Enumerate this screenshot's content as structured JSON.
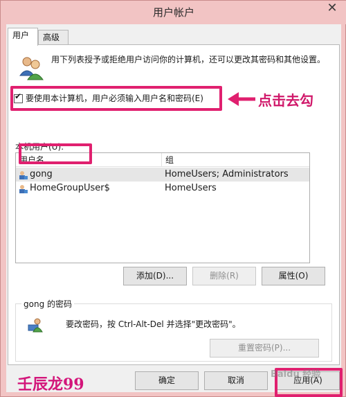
{
  "window": {
    "title": "用户帐户",
    "close_glyph": "✕"
  },
  "tabs": [
    {
      "label": "用户",
      "active": true
    },
    {
      "label": "高级",
      "active": false
    }
  ],
  "description": "用下列表授予或拒绝用户访问你的计算机，还可以更改其密码和其他设置。",
  "require_login": {
    "label": "要使用本计算机，用户必须输入用户名和密码(E)",
    "checked": true
  },
  "users_list": {
    "label": "本机用户(U):",
    "columns": [
      "用户名",
      "组"
    ],
    "rows": [
      {
        "name": "gong",
        "group": "HomeUsers; Administrators",
        "selected": true
      },
      {
        "name": "HomeGroupUser$",
        "group": "HomeUsers",
        "selected": false
      }
    ]
  },
  "list_buttons": {
    "add": "添加(D)...",
    "remove": "删除(R)",
    "properties": "属性(O)"
  },
  "password_group": {
    "title": "gong 的密码",
    "text": "要改密码，按 Ctrl-Alt-Del 并选择\"更改密码\"。",
    "reset_button": "重置密码(P)..."
  },
  "dialog_buttons": {
    "ok": "确定",
    "cancel": "取消",
    "apply": "应用(A)"
  },
  "annotations": {
    "callout_text": "点击去勾",
    "watermark": "壬辰龙99",
    "site_mark": "Baidu 经验",
    "color": "#e0206f"
  },
  "icons": [
    "users-icon",
    "user-icon",
    "keyboard-user-icon",
    "close-icon",
    "arrow-icon"
  ]
}
